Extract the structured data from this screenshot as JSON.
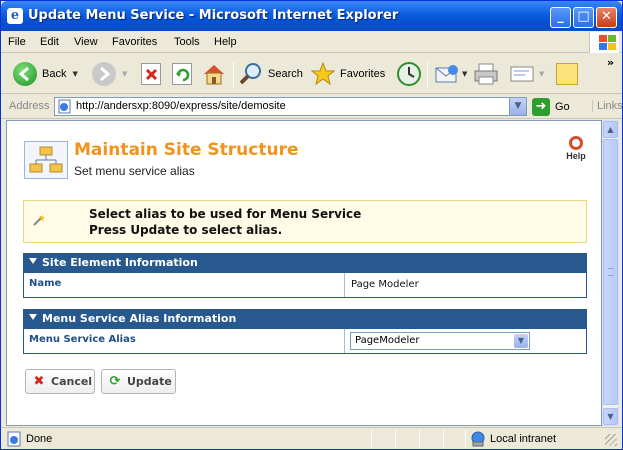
{
  "window": {
    "title": "Update Menu Service - Microsoft Internet Explorer",
    "min_label": "_",
    "max_label": "□",
    "close_label": "✕"
  },
  "menu": [
    "File",
    "Edit",
    "View",
    "Favorites",
    "Tools",
    "Help"
  ],
  "toolbar": {
    "back": "Back",
    "search": "Search",
    "favorites": "Favorites",
    "more": "»"
  },
  "address": {
    "label": "Address",
    "url": "http://andersxp:8090/express/site/demosite",
    "go": "Go",
    "links": "Links"
  },
  "page": {
    "title": "Maintain Site Structure",
    "subtitle": "Set menu service alias",
    "help": "Help",
    "info_lines": [
      "Select alias to be used for Menu Service",
      "Press Update to select alias."
    ],
    "sections": [
      {
        "title": "Site Element Information",
        "label": "Name",
        "value": "Page Modeler"
      },
      {
        "title": "Menu Service Alias Information",
        "label": "Menu Service Alias",
        "value": "PageModeler"
      }
    ],
    "buttons": {
      "cancel": "Cancel",
      "update": "Update"
    }
  },
  "status": {
    "text": "Done",
    "zone": "Local intranet"
  },
  "colors": {
    "title_accent": "#f2941c",
    "section_header": "#27598f",
    "info_bg": "#fffbe6"
  }
}
